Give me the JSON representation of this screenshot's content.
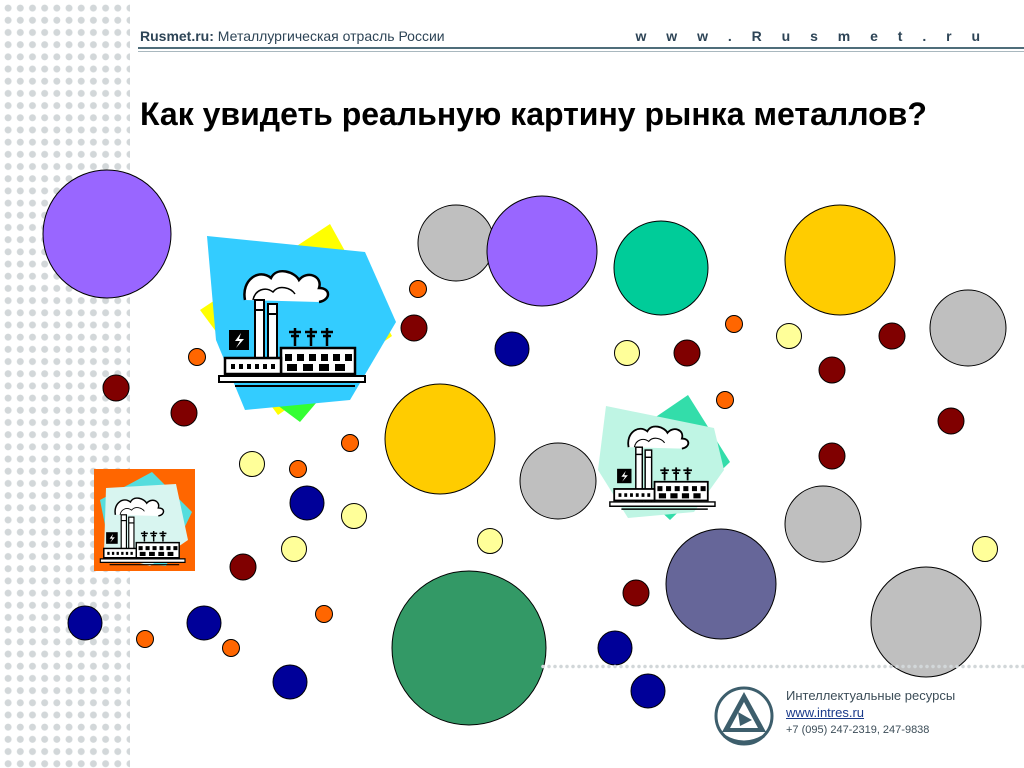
{
  "header": {
    "brand_bold": "Rusmet.ru:",
    "brand_text": "Металлургическая отрасль России",
    "site_url": "w w w . R u s m e t . r u"
  },
  "title": "Как увидеть реальную картину рынка металлов?",
  "footer": {
    "org": "Интеллектуальные ресурсы",
    "site": "www.intres.ru",
    "phone": "+7 (095) 247-2319, 247-9838"
  },
  "colors": {
    "violet": "#9966ff",
    "gray": "#bfbfbf",
    "teal": "#00cc99",
    "gold": "#ffcc00",
    "green": "#339966",
    "slate": "#666699",
    "navy": "#000099",
    "maroon": "#800000",
    "orange": "#ff6600",
    "pale_yellow": "#ffff99"
  },
  "icons": [
    "factory-clipart-icon",
    "factory-clipart-icon",
    "factory-clipart-icon",
    "intres-logo-icon"
  ]
}
